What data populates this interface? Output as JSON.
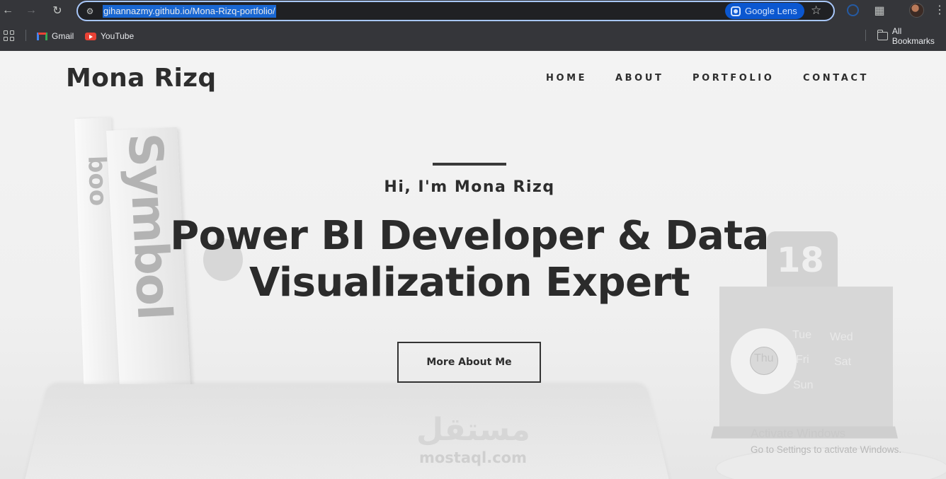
{
  "browser": {
    "url": "gihannazmy.github.io/Mona-Rizq-portfolio/",
    "lens_label": "Google Lens",
    "bookmarks": [
      {
        "label": "Gmail",
        "icon": "gmail-icon"
      },
      {
        "label": "YouTube",
        "icon": "youtube-icon"
      }
    ],
    "all_bookmarks_label": "All Bookmarks"
  },
  "site": {
    "brand": "Mona Rizq",
    "nav": [
      "HOME",
      "ABOUT",
      "PORTFOLIO",
      "CONTACT"
    ],
    "hero": {
      "greeting": "Hi, I'm Mona Rizq",
      "title_line1": "Power BI Developer & Data",
      "title_line2": "Visualization Expert",
      "button_label": "More About Me"
    }
  },
  "background": {
    "book_spine_text": "Symbol",
    "book_logo_text": "boo",
    "calendar_number": "18",
    "calendar_days": [
      "Tue",
      "Wed",
      "Thu",
      "Fri",
      "Sat",
      "Sun"
    ]
  },
  "watermark": {
    "arabic": "مستقل",
    "latin": "mostaql.com"
  },
  "os_notice": {
    "title": "Activate Windows",
    "subtitle": "Go to Settings to activate Windows."
  },
  "colors": {
    "chrome_bg": "#35363a",
    "omnibox_border": "#a8c7fa",
    "url_selection": "#1967d2",
    "lens_bg": "#0b57d0",
    "text_dark": "#2d2d2d"
  }
}
